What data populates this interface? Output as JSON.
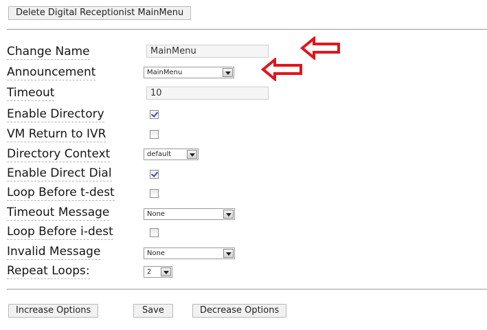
{
  "header": {
    "delete_label": "Delete Digital Receptionist MainMenu"
  },
  "form": {
    "change_name": {
      "label": "Change Name",
      "value": "MainMenu"
    },
    "announcement": {
      "label": "Announcement",
      "value": "MainMenu"
    },
    "timeout": {
      "label": "Timeout",
      "value": "10"
    },
    "enable_directory": {
      "label": "Enable Directory",
      "checked": true
    },
    "vm_return": {
      "label": "VM Return to IVR",
      "checked": false
    },
    "directory_context": {
      "label": "Directory Context",
      "value": "default"
    },
    "enable_direct_dial": {
      "label": "Enable Direct Dial",
      "checked": true
    },
    "loop_t_dest": {
      "label": "Loop Before t-dest",
      "checked": false
    },
    "timeout_message": {
      "label": "Timeout Message",
      "value": "None"
    },
    "loop_i_dest": {
      "label": "Loop Before i-dest",
      "checked": false
    },
    "invalid_message": {
      "label": "Invalid Message",
      "value": "None"
    },
    "repeat_loops": {
      "label": "Repeat Loops:",
      "value": "2"
    }
  },
  "footer": {
    "increase_label": "Increase Options",
    "save_label": "Save",
    "decrease_label": "Decrease Options"
  },
  "colors": {
    "annotation_arrow": "#e3141b",
    "checkmark": "#3a4fa0"
  },
  "icons": {
    "annotation": "red-arrow-left-icon",
    "dropdown": "chevron-down-icon"
  }
}
